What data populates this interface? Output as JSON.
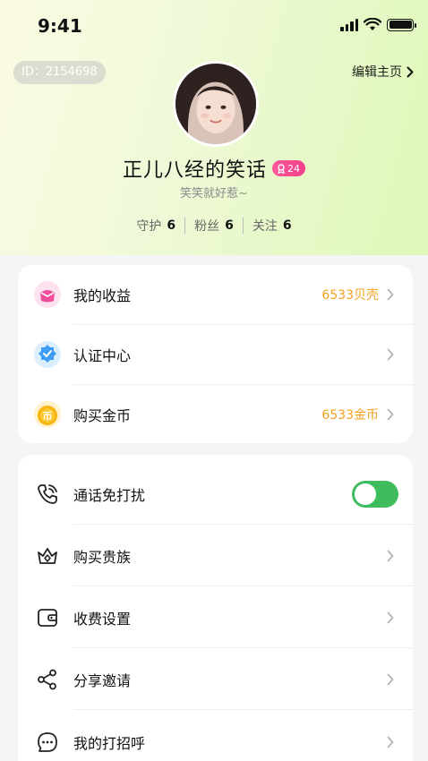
{
  "status_bar": {
    "time": "9:41"
  },
  "profile": {
    "id_text": "ID：2154698",
    "edit_label": "编辑主页",
    "nickname": "正儿八经的笑话",
    "level": "24",
    "signature": "笑笑就好惹~",
    "stats": [
      {
        "label": "守护",
        "value": "6"
      },
      {
        "label": "粉丝",
        "value": "6"
      },
      {
        "label": "关注",
        "value": "6"
      }
    ]
  },
  "menu_primary": [
    {
      "label": "我的收益",
      "value": "6533贝壳",
      "icon": "earnings-icon"
    },
    {
      "label": "认证中心",
      "value": "",
      "icon": "verify-shield-icon"
    },
    {
      "label": "购买金币",
      "value": "6533金币",
      "icon": "coin-icon"
    }
  ],
  "menu_secondary": [
    {
      "label": "通话免打扰",
      "icon": "phone-call-icon",
      "toggle_on": true
    },
    {
      "label": "购买贵族",
      "icon": "crown-icon"
    },
    {
      "label": "收费设置",
      "icon": "wallet-icon"
    },
    {
      "label": "分享邀请",
      "icon": "share-icon"
    },
    {
      "label": "我的打招呼",
      "icon": "chat-bubble-icon"
    }
  ],
  "colors": {
    "accent_orange": "#f2a11f",
    "toggle_green": "#3fbd5e",
    "badge_pink": "#f23f8a"
  }
}
